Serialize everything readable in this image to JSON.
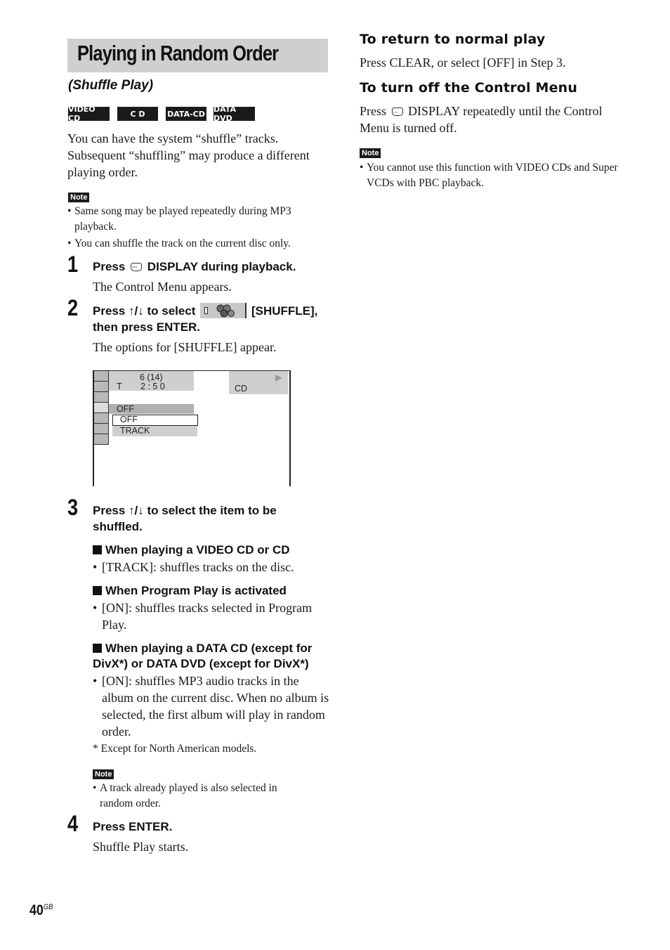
{
  "page": {
    "title": "Playing in Random Order",
    "subtitle": "(Shuffle Play)",
    "page_number": "40",
    "page_suffix": "GB"
  },
  "disc_badges": [
    "VIDEO CD",
    "C D",
    "DATA-CD",
    "DATA DVD"
  ],
  "intro": "You can have the system “shuffle” tracks. Subsequent “shuffling” may produce a different playing order.",
  "note1": {
    "label": "Note",
    "items": [
      "Same song may be played repeatedly during MP3 playback.",
      "You can shuffle the track on the current disc only."
    ]
  },
  "steps": [
    {
      "number": "1",
      "head_pre": "Press",
      "head_post": "DISPLAY during playback.",
      "body": "The Control Menu appears."
    },
    {
      "number": "2",
      "head_pre": "Press ↑/↓ to select",
      "head_post": "[SHUFFLE],",
      "head_line2": "then press ENTER.",
      "body": "The options for [SHUFFLE] appear."
    },
    {
      "number": "3",
      "head": "Press ↑/↓ to select the item to be shuffled.",
      "subsections": [
        {
          "title": "When playing a VIDEO CD or CD",
          "bullets": [
            "[TRACK]: shuffles tracks on the disc."
          ]
        },
        {
          "title": "When Program Play is activated",
          "bullets": [
            "[ON]: shuffles tracks selected in Program Play."
          ]
        },
        {
          "title": "When playing a DATA CD (except for DivX*) or DATA DVD (except for DivX*)",
          "bullets": [
            "[ON]: shuffles MP3 audio tracks in the album on the current disc. When no album is selected, the first album will play in random order."
          ]
        }
      ],
      "footnote": "*   Except for North American models.",
      "note": {
        "label": "Note",
        "items": [
          "A track already played is also selected in random order."
        ]
      }
    },
    {
      "number": "4",
      "head": "Press ENTER.",
      "body": "Shuffle Play starts."
    }
  ],
  "menu_screen": {
    "track_info": "6 (14)",
    "time_label": "T",
    "time": "2 : 5 0",
    "disc_type": "CD",
    "play_icon": "play-icon",
    "current_value": "OFF",
    "options": [
      "OFF",
      "TRACK"
    ],
    "selected_option": "OFF"
  },
  "right_column": {
    "section1": {
      "heading": "To return to normal play",
      "body": "Press CLEAR, or select [OFF] in Step 3."
    },
    "section2": {
      "heading": "To turn off the Control Menu",
      "body_pre": "Press",
      "body_post": "DISPLAY repeatedly until the Control Menu is turned off."
    },
    "note": {
      "label": "Note",
      "items": [
        "You cannot use this function with VIDEO CDs and Super VCDs with PBC playback."
      ]
    }
  }
}
